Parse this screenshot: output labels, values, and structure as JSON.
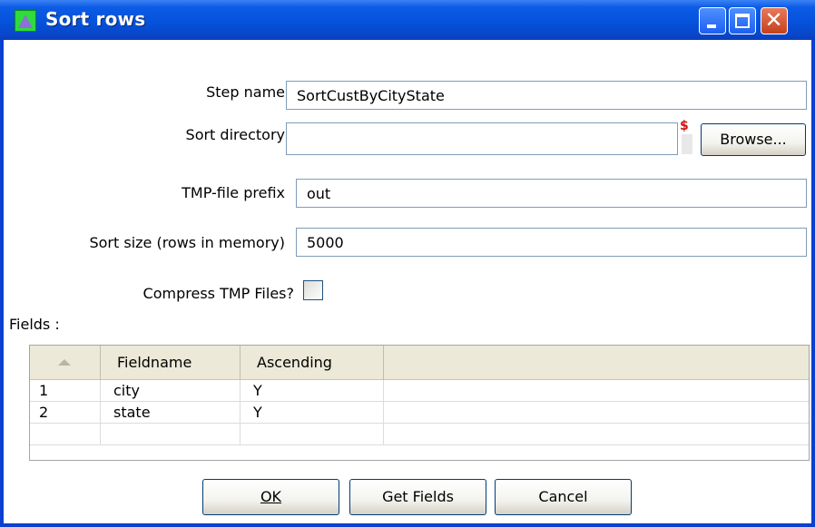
{
  "window": {
    "title": "Sort rows",
    "controls": [
      "minimize",
      "maximize",
      "close"
    ]
  },
  "form": {
    "step_name_label": "Step name",
    "step_name_value": "SortCustByCityState",
    "sort_directory_label": "Sort directory",
    "sort_directory_value": "",
    "variable_indicator": "$",
    "browse_button": "Browse...",
    "tmp_prefix_label": "TMP-file prefix",
    "tmp_prefix_value": "out",
    "sort_size_label": "Sort size (rows in memory)",
    "sort_size_value": "5000",
    "compress_label": "Compress TMP Files?",
    "compress_checked": false
  },
  "fields": {
    "label": "Fields :",
    "columns": [
      "Fieldname",
      "Ascending"
    ],
    "rows": [
      {
        "num": "1",
        "fieldname": "city",
        "ascending": "Y"
      },
      {
        "num": "2",
        "fieldname": "state",
        "ascending": "Y"
      }
    ]
  },
  "buttons": {
    "ok": "OK",
    "get_fields": "Get Fields",
    "cancel": "Cancel"
  },
  "colors": {
    "titlebar": "#0552dc",
    "close_button": "#c6401c",
    "app_icon": "#2fdc3a"
  },
  "icons": {
    "app": "spoon-triangle-icon",
    "minimize": "minimize-icon",
    "maximize": "maximize-icon",
    "close": "close-icon"
  }
}
